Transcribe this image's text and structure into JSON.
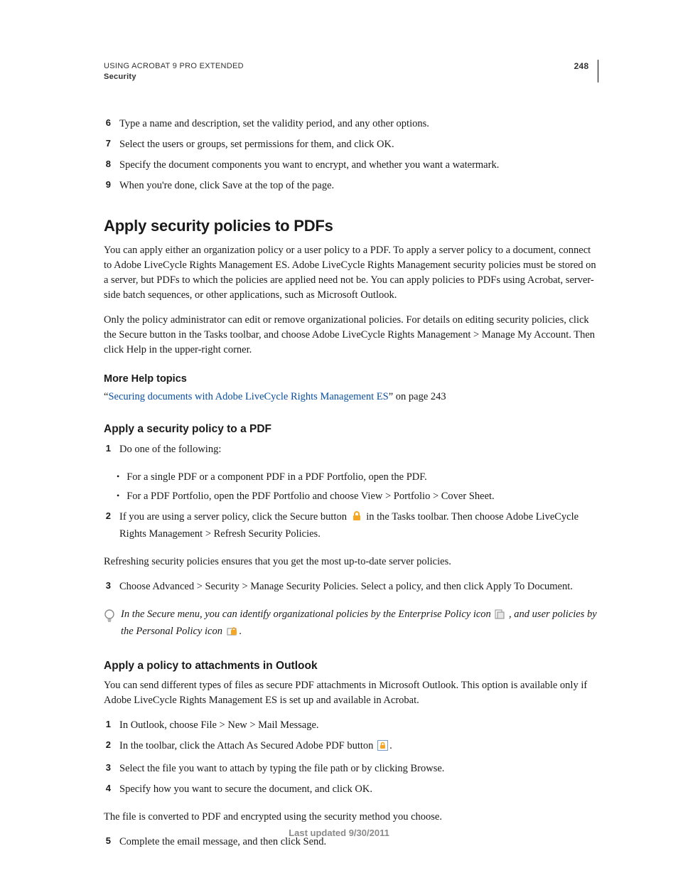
{
  "header": {
    "doc_title": "USING ACROBAT 9 PRO EXTENDED",
    "section": "Security",
    "page_number": "248"
  },
  "steps_top": [
    {
      "n": "6",
      "t": "Type a name and description, set the validity period, and any other options."
    },
    {
      "n": "7",
      "t": "Select the users or groups, set permissions for them, and click OK."
    },
    {
      "n": "8",
      "t": "Specify the document components you want to encrypt, and whether you want a watermark."
    },
    {
      "n": "9",
      "t": "When you're done, click Save at the top of the page."
    }
  ],
  "h2": "Apply security policies to PDFs",
  "para1": "You can apply either an organization policy or a user policy to a PDF. To apply a server policy to a document, connect to Adobe LiveCycle Rights Management ES. Adobe LiveCycle Rights Management security policies must be stored on a server, but PDFs to which the policies are applied need not be. You can apply policies to PDFs using Acrobat, server-side batch sequences, or other applications, such as Microsoft Outlook.",
  "para2": "Only the policy administrator can edit or remove organizational policies. For details on editing security policies, click the Secure button in the Tasks toolbar, and choose Adobe LiveCycle Rights Management > Manage My Account. Then click Help in the upper-right corner.",
  "more_help": {
    "label": "More Help topics",
    "link_text": "Securing documents with Adobe LiveCycle Rights Management ES",
    "suffix": " on page 243"
  },
  "sub1": {
    "title": "Apply a security policy to a PDF",
    "step1": "Do one of the following:",
    "bullets": [
      "For a single PDF or a component PDF in a PDF Portfolio, open the PDF.",
      "For a PDF Portfolio, open the PDF Portfolio and choose View > Portfolio > Cover Sheet."
    ],
    "step2_a": "If you are using a server policy, click the Secure button ",
    "step2_b": " in the Tasks toolbar. Then choose Adobe LiveCycle Rights Management > Refresh Security Policies.",
    "refresh_note": "Refreshing security policies ensures that you get the most up-to-date server policies.",
    "step3": "Choose Advanced > Security > Manage Security Policies. Select a policy, and then click Apply To Document.",
    "tip_a": "In the Secure menu, you can identify organizational policies by the Enterprise Policy icon ",
    "tip_b": ", and user policies by the Personal Policy icon ",
    "tip_c": "."
  },
  "sub2": {
    "title": "Apply a policy to attachments in Outlook",
    "intro": "You can send different types of files as secure PDF attachments in Microsoft Outlook. This option is available only if Adobe LiveCycle Rights Management ES is set up and available in Acrobat.",
    "step1": "In Outlook, choose File > New > Mail Message.",
    "step2_a": "In the toolbar, click the Attach As Secured Adobe PDF button ",
    "step2_b": ".",
    "step3": "Select the file you want to attach by typing the file path or by clicking Browse.",
    "step4": "Specify how you want to secure the document, and click OK.",
    "note": "The file is converted to PDF and encrypted using the security method you choose.",
    "step5": "Complete the email message, and then click Send."
  },
  "footer": "Last updated 9/30/2011"
}
